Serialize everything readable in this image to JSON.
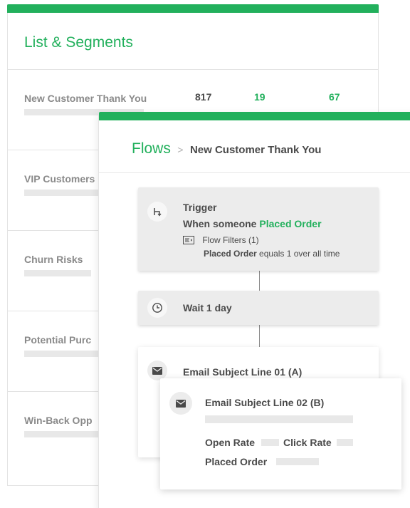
{
  "segments": {
    "title": "List & Segments",
    "rows": [
      {
        "label": "New Customer Thank You",
        "values": [
          "817",
          "19",
          "67"
        ]
      },
      {
        "label": "VIP Customers"
      },
      {
        "label": "Churn Risks"
      },
      {
        "label": "Potential Purc"
      },
      {
        "label": "Win-Back Opp"
      }
    ]
  },
  "flow": {
    "breadcrumb_root": "Flows",
    "breadcrumb_sep": ">",
    "breadcrumb_current": "New Customer Thank You",
    "trigger": {
      "title": "Trigger",
      "when_prefix": "When someone",
      "when_event": "Placed Order",
      "filters_label": "Flow Filters (1)",
      "filter_metric": "Placed Order",
      "filter_rest": "equals 1 over all time",
      "icon": "split-icon"
    },
    "wait": {
      "title": "Wait 1 day",
      "icon": "clock-icon"
    },
    "email_a": {
      "title": "Email Subject Line 01 (A)",
      "icon": "mail-icon"
    },
    "email_b": {
      "title": "Email Subject Line 02 (B)",
      "open_rate_label": "Open Rate",
      "click_rate_label": "Click Rate",
      "placed_order_label": "Placed Order",
      "icon": "mail-icon"
    }
  },
  "colors": {
    "brand_green": "#22b05c"
  }
}
